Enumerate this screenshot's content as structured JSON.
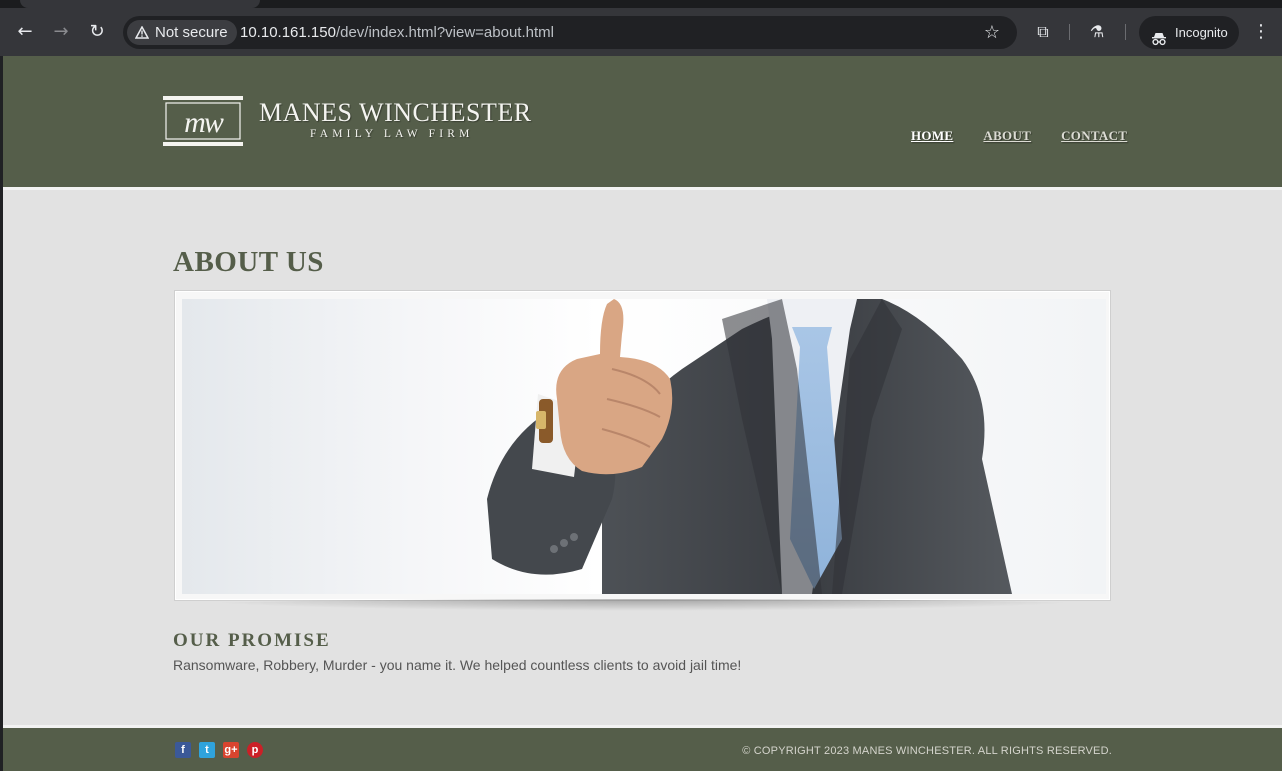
{
  "browser": {
    "security_label": "Not secure",
    "url_host": "10.10.161.150",
    "url_path": "/dev/index.html?view=about.html",
    "incognito_label": "Incognito"
  },
  "site": {
    "logo_monogram": "MW",
    "logo_name": "MANES WINCHESTER",
    "logo_subtitle": "FAMILY LAW FIRM",
    "nav": {
      "home": "HOME",
      "about": "ABOUT",
      "contact": "CONTACT"
    },
    "colors": {
      "header_bg": "#555e4a",
      "page_bg": "#e2e2e2",
      "accent_text": "#555e4a"
    }
  },
  "main": {
    "title": "ABOUT US",
    "hero_image_description_icon": "businessman-thumbs-up-photo",
    "promise_heading": "OUR PROMISE",
    "promise_text": "Ransomware, Robbery, Murder - you name it. We helped countless clients to avoid jail time!"
  },
  "footer": {
    "social": [
      "facebook-icon",
      "twitter-icon",
      "google-plus-icon",
      "pinterest-icon"
    ],
    "copyright": "© COPYRIGHT 2023 MANES WINCHESTER. ALL RIGHTS RESERVED."
  }
}
